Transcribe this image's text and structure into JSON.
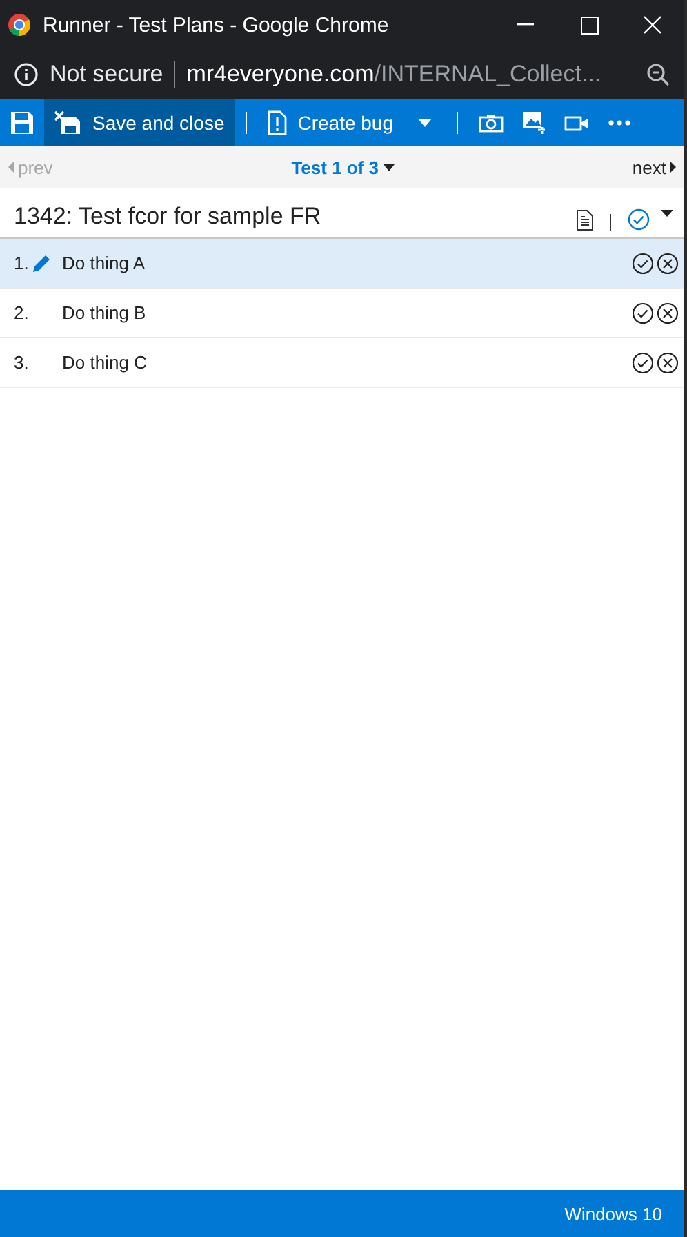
{
  "window": {
    "title": "Runner - Test Plans - Google Chrome"
  },
  "address_bar": {
    "security": "Not secure",
    "domain": "mr4everyone.com",
    "path": "/INTERNAL_Collect..."
  },
  "toolbar": {
    "buttons": [
      {
        "kind": "save",
        "selected": false
      },
      {
        "kind": "save-close",
        "label": "Save and close",
        "selected": true
      },
      {
        "kind": "bug",
        "label": "Create bug",
        "selected": false
      }
    ]
  },
  "navigation": {
    "prev": {
      "label": "prev",
      "disabled": true
    },
    "current": "Test 1 of 3",
    "next": {
      "label": "next",
      "disabled": false
    }
  },
  "test": {
    "title": "1342: Test fcor for sample FR"
  },
  "steps": [
    {
      "number": "1.",
      "text": "Do thing A",
      "selected": true
    },
    {
      "number": "2.",
      "text": "Do thing B",
      "selected": false
    },
    {
      "number": "3.",
      "text": "Do thing C",
      "selected": false
    }
  ],
  "status_bar": {
    "text": "Windows 10"
  }
}
